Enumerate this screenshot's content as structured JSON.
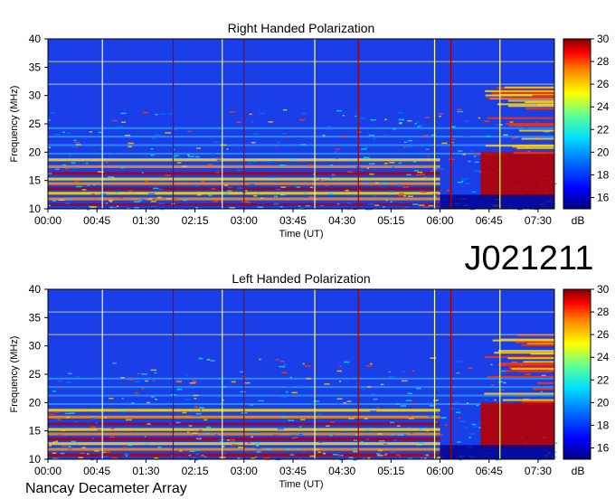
{
  "chart_data": [
    {
      "type": "heatmap",
      "title": "Right Handed Polarization",
      "xlabel": "Time (UT)",
      "ylabel": "Frequency (MHz)",
      "xticks": [
        "00:00",
        "00:45",
        "01:30",
        "02:15",
        "03:00",
        "03:45",
        "04:30",
        "05:15",
        "06:00",
        "06:45",
        "07:30"
      ],
      "yticks": [
        10,
        15,
        20,
        25,
        30,
        35,
        40
      ],
      "ylim": [
        10,
        40
      ],
      "xlim": [
        "00:00",
        "07:45"
      ],
      "colorbar": {
        "label": "dB",
        "range": [
          15,
          30
        ],
        "ticks": [
          16,
          18,
          20,
          22,
          24,
          26,
          28,
          30
        ]
      }
    },
    {
      "type": "heatmap",
      "title": "Left Handed Polarization",
      "xlabel": "Time (UT)",
      "ylabel": "Frequency (MHz)",
      "xticks": [
        "00:00",
        "00:45",
        "01:30",
        "02:15",
        "03:00",
        "03:45",
        "04:30",
        "05:15",
        "06:00",
        "06:45",
        "07:30"
      ],
      "yticks": [
        10,
        15,
        20,
        25,
        30,
        35,
        40
      ],
      "ylim": [
        10,
        40
      ],
      "xlim": [
        "00:00",
        "07:45"
      ],
      "colorbar": {
        "label": "dB",
        "range": [
          15,
          30
        ],
        "ticks": [
          16,
          18,
          20,
          22,
          24,
          26,
          28,
          30
        ]
      }
    }
  ],
  "observation_id": "J021211",
  "instrument": "Nancay Decameter Array"
}
